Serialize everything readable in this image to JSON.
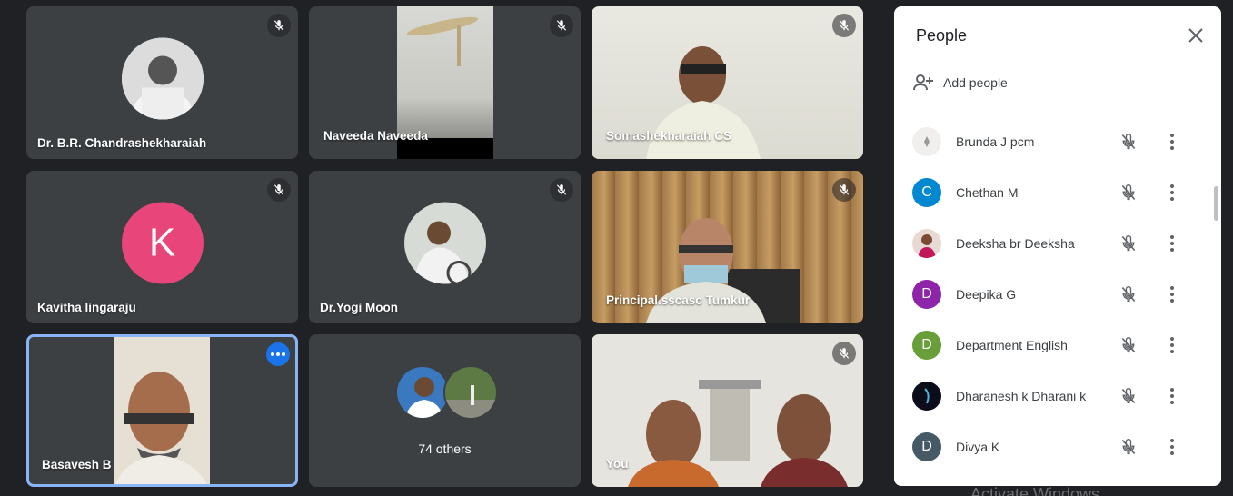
{
  "tiles": [
    {
      "name": "Dr. B.R. Chandrashekharaiah"
    },
    {
      "name": "Naveeda Naveeda"
    },
    {
      "name": "Somashekharaiah CS"
    },
    {
      "name": "Kavitha lingaraju",
      "avatar_letter": "K"
    },
    {
      "name": "Dr.Yogi Moon"
    },
    {
      "name": "Principal.sscasc Tumkur"
    },
    {
      "name": "Basavesh B"
    },
    {
      "name": "74 others"
    },
    {
      "name": "You"
    }
  ],
  "colors": {
    "background": "#202124",
    "tile": "#3c4043",
    "active_border": "#8ab4f8",
    "kavitha_avatar": "#e8467a",
    "chethan_avatar": "#0288d1",
    "deepika_avatar": "#8e24aa",
    "department_avatar": "#689f38",
    "divya_avatar": "#455a64"
  },
  "panel": {
    "title": "People",
    "add_people": "Add people",
    "participants": [
      {
        "name": "Brunda J pcm",
        "avatar_type": "image"
      },
      {
        "name": "Chethan M",
        "avatar_letter": "C"
      },
      {
        "name": "Deeksha br Deeksha",
        "avatar_type": "image"
      },
      {
        "name": "Deepika G",
        "avatar_letter": "D"
      },
      {
        "name": "Department English",
        "avatar_letter": "D"
      },
      {
        "name": "Dharanesh k Dharani k",
        "avatar_type": "image"
      },
      {
        "name": "Divya K",
        "avatar_letter": "D"
      }
    ]
  },
  "watermark": "Activate Windows"
}
